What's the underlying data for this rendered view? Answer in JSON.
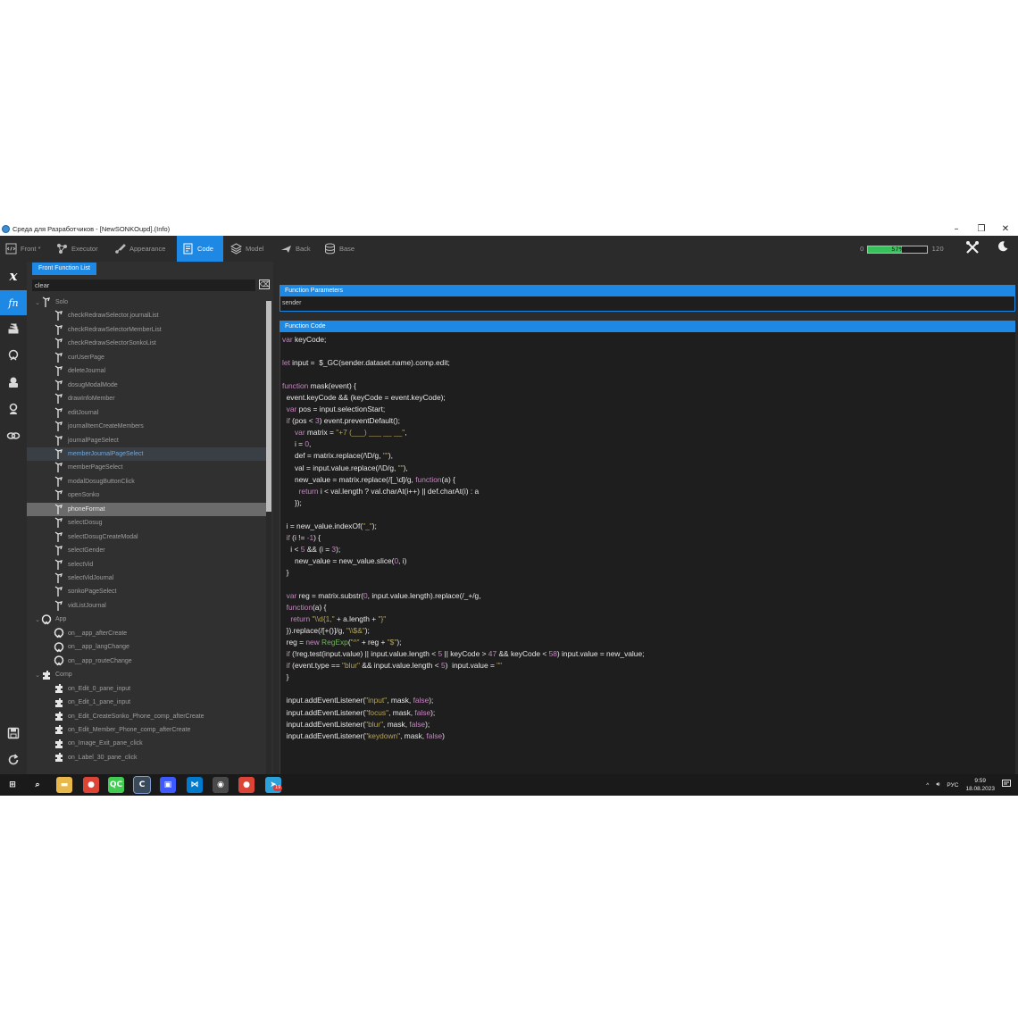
{
  "window": {
    "title": "Среда для Разработчиков - [NewSONKOupd].(Info)",
    "controls": {
      "minimize": "–",
      "maximize": "❐",
      "close": "✕"
    }
  },
  "toolbar": {
    "items": [
      {
        "label": "Front *",
        "icon": "code-tag-icon"
      },
      {
        "label": "Executor",
        "icon": "graph-nodes-icon"
      },
      {
        "label": "Appearance",
        "icon": "brush-icon"
      },
      {
        "label": "Code",
        "icon": "code-file-icon",
        "active": true
      },
      {
        "label": "Model",
        "icon": "layers-icon"
      },
      {
        "label": "Back",
        "icon": "plane-icon"
      },
      {
        "label": "Base",
        "icon": "database-icon"
      }
    ],
    "progress": {
      "min": "0",
      "max": "120",
      "value_text": "57%",
      "fraction": 0.57
    }
  },
  "left_panel": {
    "tab_label": "Front Function List",
    "search_value": "clear",
    "tree": [
      {
        "label": "Solo",
        "kind": "group",
        "icon": "solo"
      },
      {
        "label": "checkRedrawSelector.journalList",
        "kind": "item",
        "icon": "solo"
      },
      {
        "label": "checkRedrawSelectorMemberList",
        "kind": "item",
        "icon": "solo"
      },
      {
        "label": "checkRedrawSelectorSonkoList",
        "kind": "item",
        "icon": "solo"
      },
      {
        "label": "curUserPage",
        "kind": "item",
        "icon": "solo"
      },
      {
        "label": "deleteJournal",
        "kind": "item",
        "icon": "solo"
      },
      {
        "label": "dosugModalMode",
        "kind": "item",
        "icon": "solo"
      },
      {
        "label": "drawInfoMember",
        "kind": "item",
        "icon": "solo"
      },
      {
        "label": "editJournal",
        "kind": "item",
        "icon": "solo"
      },
      {
        "label": "journalItemCreateMembers",
        "kind": "item",
        "icon": "solo"
      },
      {
        "label": "journalPageSelect",
        "kind": "item",
        "icon": "solo"
      },
      {
        "label": "memberJournalPageSelect",
        "kind": "item",
        "icon": "solo",
        "state": "hover"
      },
      {
        "label": "memberPageSelect",
        "kind": "item",
        "icon": "solo"
      },
      {
        "label": "modalDosugButtonClick",
        "kind": "item",
        "icon": "solo"
      },
      {
        "label": "openSonko",
        "kind": "item",
        "icon": "solo"
      },
      {
        "label": "phoneFormat",
        "kind": "item",
        "icon": "solo",
        "state": "selected"
      },
      {
        "label": "selectDosug",
        "kind": "item",
        "icon": "solo"
      },
      {
        "label": "selectDosugCreateModal",
        "kind": "item",
        "icon": "solo"
      },
      {
        "label": "selectGender",
        "kind": "item",
        "icon": "solo"
      },
      {
        "label": "selectVid",
        "kind": "item",
        "icon": "solo"
      },
      {
        "label": "selectVidJournal",
        "kind": "item",
        "icon": "solo"
      },
      {
        "label": "sonkoPageSelect",
        "kind": "item",
        "icon": "solo"
      },
      {
        "label": "vidListJournal",
        "kind": "item",
        "icon": "solo"
      },
      {
        "label": "App",
        "kind": "group",
        "icon": "app"
      },
      {
        "label": "on__app_afterCreate",
        "kind": "item",
        "icon": "app"
      },
      {
        "label": "on__app_langChange",
        "kind": "item",
        "icon": "app"
      },
      {
        "label": "on__app_routeChange",
        "kind": "item",
        "icon": "app"
      },
      {
        "label": "Comp",
        "kind": "group",
        "icon": "comp"
      },
      {
        "label": "on_Edit_0_pane_input",
        "kind": "item",
        "icon": "comp"
      },
      {
        "label": "on_Edit_1_pane_input",
        "kind": "item",
        "icon": "comp"
      },
      {
        "label": "on_Edit_CreateSonko_Phone_comp_afterCreate",
        "kind": "item",
        "icon": "comp"
      },
      {
        "label": "on_Edit_Member_Phone_comp_afterCreate",
        "kind": "item",
        "icon": "comp"
      },
      {
        "label": "on_Image_Exit_pane_click",
        "kind": "item",
        "icon": "comp"
      },
      {
        "label": "on_Label_30_pane_click",
        "kind": "item",
        "icon": "comp"
      }
    ]
  },
  "right_panel": {
    "params_header": "Function Parameters",
    "params_value": "sender",
    "code_header": "Function Code",
    "code_lines": [
      "<span class=\"kw\">var</span> keyCode;",
      "",
      "<span class=\"kw\">let</span> input =  $_GC(sender.dataset.name).comp.edit;",
      "",
      "<span class=\"kw\">function</span> mask(event) {",
      "  event.keyCode &amp;&amp; (keyCode = event.keyCode);",
      "  <span class=\"kw\">var</span> pos = input.selectionStart;",
      "  <span class=\"kw\">if</span> (pos &lt; <span class=\"num\">3</span>) event.preventDefault();",
      "      <span class=\"kw\">var</span> matrix = <span class=\"str\">\"+7 (___) ___ __ __\"</span>,",
      "      i = <span class=\"num\">0</span>,",
      "      def = matrix.replace(/\\D/g, <span class=\"str\">\"\"</span>),",
      "      val = input.value.replace(/\\D/g, <span class=\"str\">\"\"</span>),",
      "      new_value = matrix.replace(/[_\\d]/g, <span class=\"kw\">function</span>(a) {",
      "        <span class=\"kw\">return</span> i &lt; val.length ? val.charAt(i++) || def.charAt(i) : a",
      "      });",
      "",
      "  i = new_value.indexOf(<span class=\"str\">\"_\"</span>);",
      "  <span class=\"kw\">if</span> (i != <span class=\"num\">-1</span>) {",
      "    i &lt; <span class=\"num\">5</span> &amp;&amp; (i = <span class=\"num\">3</span>);",
      "      new_value = new_value.slice(<span class=\"num\">0</span>, i)",
      "  }",
      "",
      "  <span class=\"kw\">var</span> reg = matrix.substr(<span class=\"num\">0</span>, input.value.length).replace(/_+/g,",
      "  <span class=\"kw\">function</span>(a) {",
      "    <span class=\"kw\">return</span> <span class=\"str\">\"\\\\d{1,\"</span> + a.length + <span class=\"str\">\"}\"</span>",
      "  }).replace(/[+()]/g, <span class=\"str\">\"\\\\$&amp;\"</span>);",
      "  reg = <span class=\"kw\">new</span> <span class=\"fn\">RegExp</span>(<span class=\"str\">\"^\"</span> + reg + <span class=\"str\">\"$\"</span>);",
      "  <span class=\"kw\">if</span> (!reg.test(input.value) || input.value.length &lt; <span class=\"num\">5</span> || keyCode &gt; <span class=\"num\">47</span> &amp;&amp; keyCode &lt; <span class=\"num\">58</span>) input.value = new_value;",
      "  <span class=\"kw\">if</span> (event.type == <span class=\"str\">\"blur\"</span> &amp;&amp; input.value.length &lt; <span class=\"num\">5</span>)  input.value = <span class=\"str\">\"\"</span>",
      "  }",
      "",
      "  input.addEventListener(<span class=\"str\">\"input\"</span>, mask, <span class=\"kw\">false</span>);",
      "  input.addEventListener(<span class=\"str\">\"focus\"</span>, mask, <span class=\"kw\">false</span>);",
      "  input.addEventListener(<span class=\"str\">\"blur\"</span>, mask, <span class=\"kw\">false</span>);",
      "  input.addEventListener(<span class=\"str\">\"keydown\"</span>, mask, <span class=\"kw\">false</span>)"
    ]
  },
  "taskbar": {
    "lang": "РУС",
    "time": "9:59",
    "date": "18.08.2023",
    "apps": [
      {
        "name": "windows-start-icon",
        "color": "#1a1a1a"
      },
      {
        "name": "search-icon",
        "color": "#1a1a1a"
      },
      {
        "name": "file-explorer-icon",
        "color": "#e8b84a"
      },
      {
        "name": "chrome-icon",
        "color": "#db4437"
      },
      {
        "name": "qt-creator-icon",
        "color": "#41cd52"
      },
      {
        "name": "dev-environment-icon",
        "color": "#3b8ed6"
      },
      {
        "name": "save-app-icon",
        "color": "#3d5afe"
      },
      {
        "name": "vscode-icon",
        "color": "#007acc"
      },
      {
        "name": "steam-like-icon",
        "color": "#4a4a4a"
      },
      {
        "name": "chrome-2-icon",
        "color": "#db4437"
      },
      {
        "name": "telegram-icon",
        "color": "#2aa1da"
      }
    ],
    "telegram_badge": "19"
  }
}
